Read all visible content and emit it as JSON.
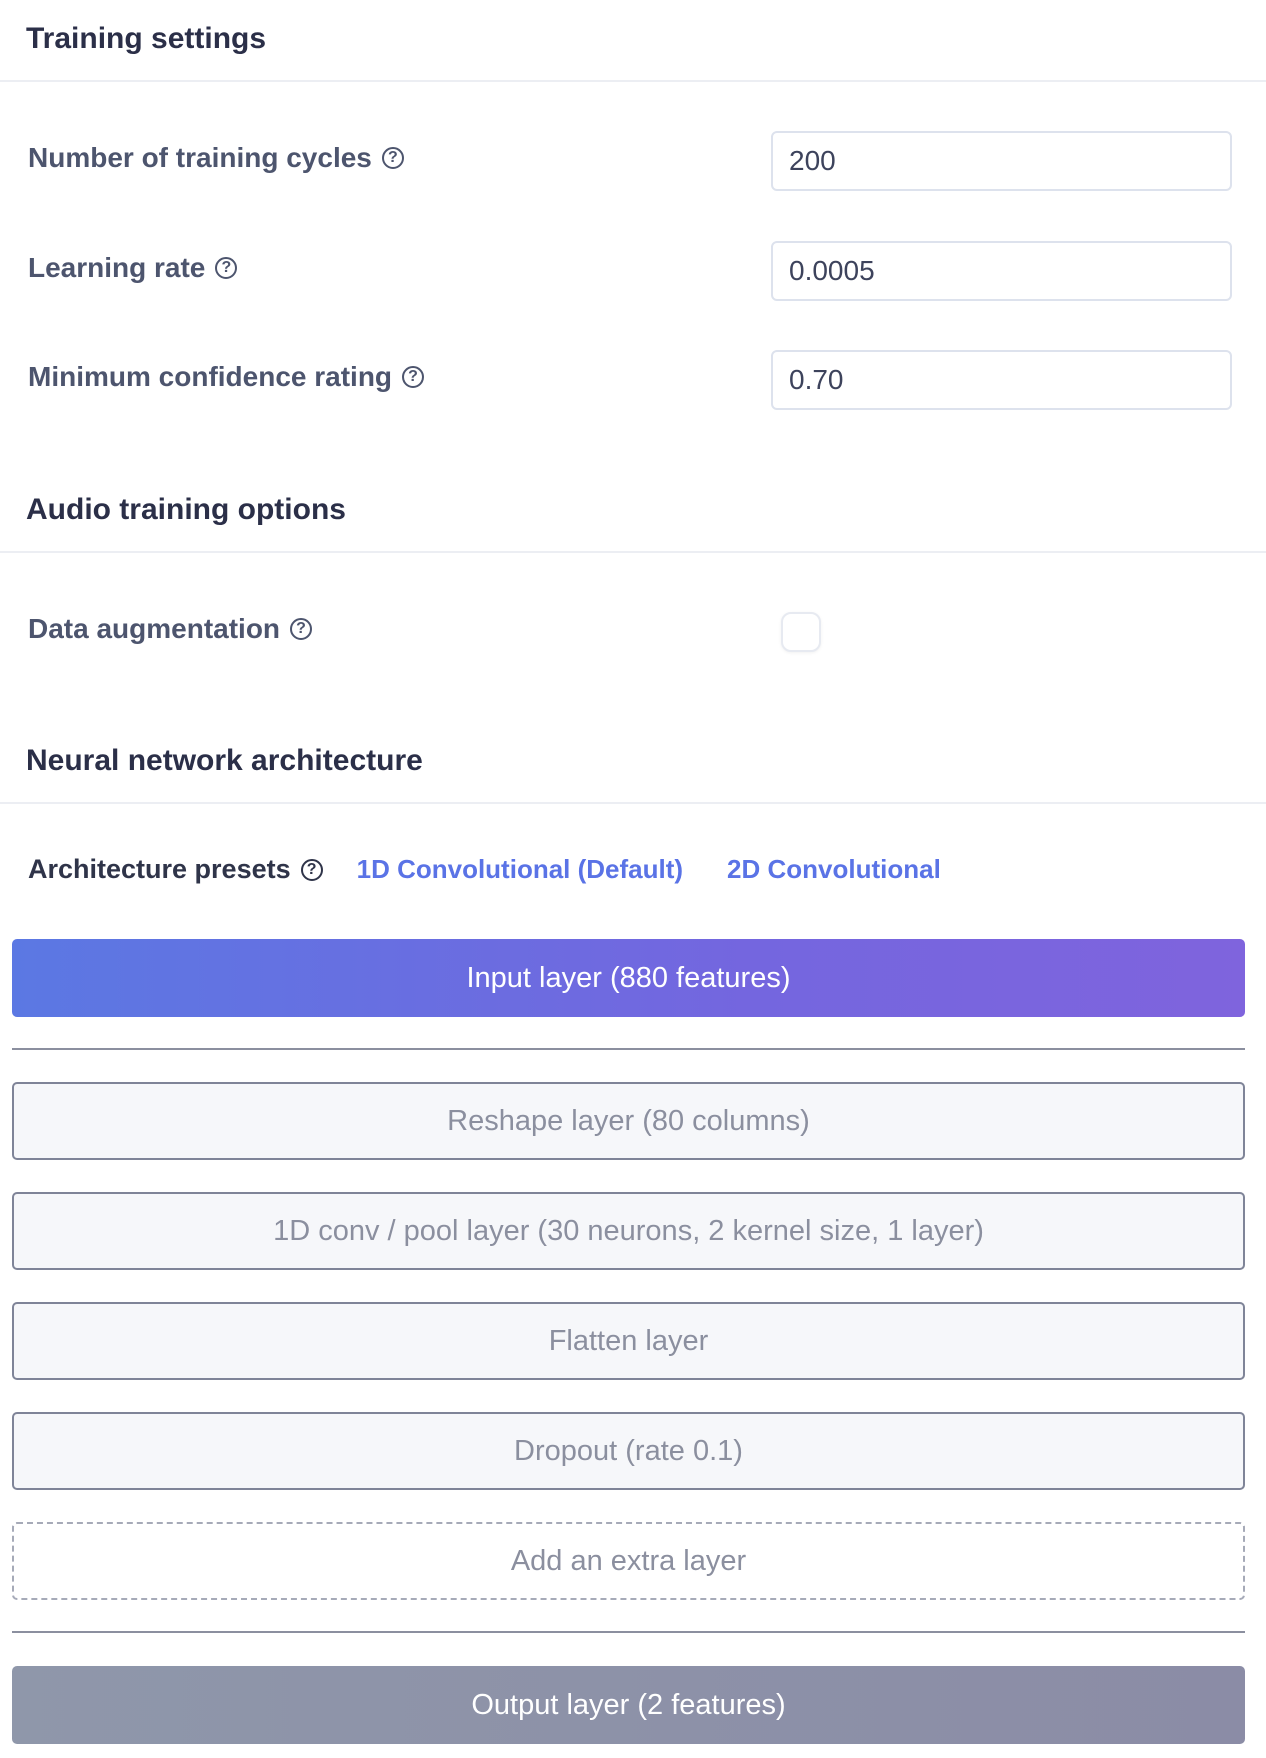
{
  "training_settings": {
    "title": "Training settings",
    "fields": [
      {
        "label": "Number of training cycles",
        "value": "200"
      },
      {
        "label": "Learning rate",
        "value": "0.0005"
      },
      {
        "label": "Minimum confidence rating",
        "value": "0.70"
      }
    ]
  },
  "audio_options": {
    "title": "Audio training options",
    "data_augmentation_label": "Data augmentation",
    "data_augmentation_checked": false
  },
  "nn_architecture": {
    "title": "Neural network architecture",
    "presets_label": "Architecture presets",
    "presets": [
      "1D Convolutional (Default)",
      "2D Convolutional"
    ],
    "input_layer": "Input layer (880 features)",
    "layers": [
      "Reshape layer (80 columns)",
      "1D conv / pool layer (30 neurons, 2 kernel size, 1 layer)",
      "Flatten layer",
      "Dropout (rate 0.1)"
    ],
    "add_layer": "Add an extra layer",
    "output_layer": "Output layer (2 features)"
  },
  "icons": {
    "help": "help-circle-icon"
  },
  "colors": {
    "accent": "#5a73e6",
    "input_gradient_start": "#5b78e3",
    "input_gradient_end": "#7f64dd",
    "output": "#8f97aa"
  }
}
